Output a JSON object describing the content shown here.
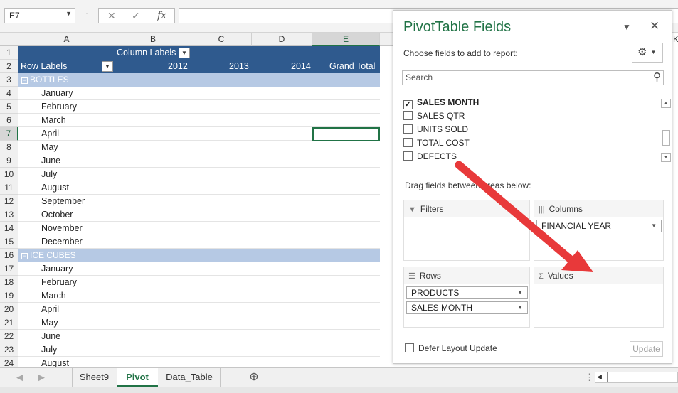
{
  "formula_bar": {
    "name_box": "E7",
    "fx_label": "fx",
    "cancel_glyph": "✕",
    "enter_glyph": "✓"
  },
  "columns": [
    "A",
    "B",
    "C",
    "D",
    "E"
  ],
  "selected_column": "E",
  "rows": [
    "1",
    "2",
    "3",
    "4",
    "5",
    "6",
    "7",
    "8",
    "9",
    "10",
    "11",
    "12",
    "13",
    "14",
    "15",
    "16",
    "17",
    "18",
    "19",
    "20",
    "21",
    "22",
    "23",
    "24"
  ],
  "selected_row": "7",
  "pivot": {
    "column_labels": "Column Labels",
    "row_labels": "Row Labels",
    "years": [
      "2012",
      "2013",
      "2014"
    ],
    "grand_total": "Grand Total",
    "group1": "BOTTLES",
    "group1_months": [
      "January",
      "February",
      "March",
      "April",
      "May",
      "June",
      "July",
      "August",
      "September",
      "October",
      "November",
      "December"
    ],
    "group2": "ICE CUBES",
    "group2_months": [
      "January",
      "February",
      "March",
      "April",
      "May",
      "June",
      "July",
      "August"
    ]
  },
  "sheet_tabs": [
    "Sheet9",
    "Pivot",
    "Data_Table"
  ],
  "active_tab": "Pivot",
  "panel": {
    "title": "PivotTable Fields",
    "choose_label": "Choose fields to add to report:",
    "search_placeholder": "Search",
    "fields": [
      {
        "name": "SALES MONTH",
        "checked": true
      },
      {
        "name": "SALES QTR",
        "checked": false
      },
      {
        "name": "UNITS SOLD",
        "checked": false
      },
      {
        "name": "TOTAL COST",
        "checked": false
      },
      {
        "name": "DEFECTS",
        "checked": false
      }
    ],
    "drag_label": "Drag fields between areas below:",
    "areas": {
      "filters": {
        "label": "Filters",
        "items": []
      },
      "columns": {
        "label": "Columns",
        "items": [
          "FINANCIAL YEAR"
        ]
      },
      "rows": {
        "label": "Rows",
        "items": [
          "PRODUCTS",
          "SALES MONTH"
        ]
      },
      "values": {
        "label": "Values",
        "items": []
      }
    },
    "defer_label": "Defer Layout Update",
    "update_label": "Update"
  },
  "annotation_arrow_color": "#e8393a",
  "accent_color": "#217346",
  "pivot_header_color": "#2f5a8e",
  "pivot_group_color": "#b6c9e4"
}
